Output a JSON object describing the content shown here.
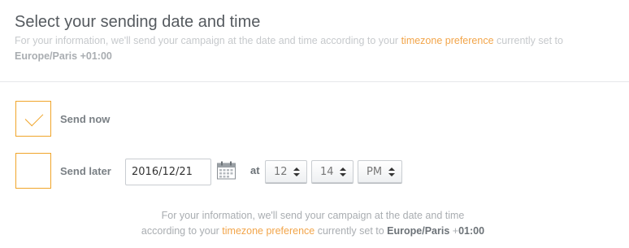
{
  "header": {
    "title": "Select your sending date and time",
    "info_prefix": "For your information, we'll send your campaign at the date and time according to your ",
    "info_link": "timezone preference",
    "info_suffix": " currently set to",
    "timezone": "Europe/Paris +01:00"
  },
  "options": {
    "send_now": {
      "label": "Send now",
      "checked": true
    },
    "send_later": {
      "label": "Send later",
      "checked": false
    }
  },
  "schedule": {
    "date_value": "2016/12/21",
    "at_label": "at",
    "hour": "12",
    "minute": "14",
    "ampm": "PM"
  },
  "footer": {
    "line1": "For your information, we'll send your campaign at the date and time",
    "line2_prefix": "according to your ",
    "link": "timezone preference",
    "line2_middle": " currently set to ",
    "timezone_name": "Europe/Paris",
    "timezone_offset_sign": " +",
    "timezone_offset": "01:00"
  },
  "colors": {
    "accent": "#f0a52a",
    "link": "#f2a54a"
  },
  "icons": {
    "check": "check-icon",
    "calendar": "calendar-icon",
    "spinner": "updown-arrows-icon"
  }
}
